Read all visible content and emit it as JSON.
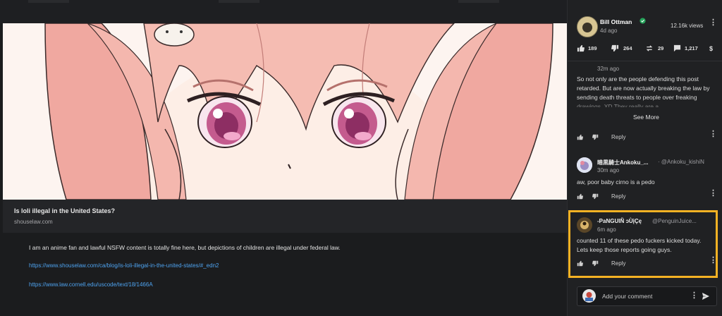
{
  "post": {
    "link_card": {
      "title": "Is loli illegal in the United States?",
      "domain": "shouselaw.com"
    },
    "body_text": "I am an anime fan and lawful NSFW content is totally fine here, but depictions of children are illegal under federal law.",
    "links": [
      "https://www.shouselaw.com/ca/blog/is-loli-illegal-in-the-united-states/#_edn2",
      "https://www.law.cornell.edu/uscode/text/18/1466A"
    ]
  },
  "owner": {
    "name": "Bill Ottman",
    "time": "4d ago",
    "views": "12.16k views",
    "verified_icon": "verified-check-icon",
    "verified_color": "#25a35a"
  },
  "actions": {
    "upvotes": "189",
    "downvotes": "264",
    "reminds": "29",
    "comments": "1,217"
  },
  "comments": [
    {
      "name": "",
      "handle": "",
      "time": "32m ago",
      "text": "So not only are the people defending this post retarded. But are now actually breaking the law by sending death threats to people over freaking drawings. XD They really are a",
      "see_more": "See More",
      "reply": "Reply"
    },
    {
      "name": "暗黒騎士Ankoku_...",
      "handle": "· @Ankoku_kishiN",
      "time": "30m ago",
      "text": "aw, poor baby cirno is a pedo",
      "reply": "Reply"
    },
    {
      "name": "-PaNGUIÑ ɔÙįÇę",
      "handle": "@PenguinJuice...",
      "time": "6m ago",
      "text": "counted 11 of these pedo fuckers kicked today. Lets keep those reports going guys.",
      "reply": "Reply"
    }
  ],
  "composer": {
    "placeholder": "Add your comment",
    "send_icon": "send-icon"
  },
  "colors": {
    "accent_link": "#4ea3f0",
    "highlight_border": "#f5b224",
    "background": "#1b1c1e"
  }
}
